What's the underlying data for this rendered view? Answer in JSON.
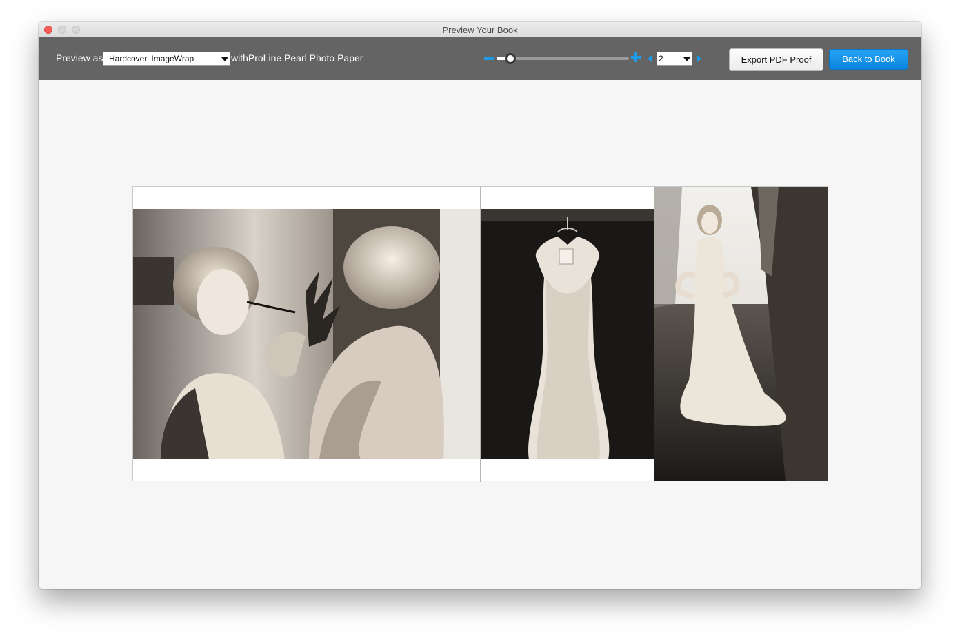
{
  "window": {
    "title": "Preview Your Book"
  },
  "toolbar": {
    "preview_as_label": "Preview as",
    "cover_select_value": "Hardcover, ImageWrap",
    "paper_label": "withProLine Pearl Photo Paper",
    "zoom_level": 0.08,
    "page_value": "2",
    "export_button_label": "Export PDF Proof",
    "back_button_label": "Back to Book"
  },
  "icons": {
    "zoom_out": "minus-icon",
    "zoom_in": "plus-icon",
    "prev_page": "chevron-left-icon",
    "next_page": "chevron-right-icon"
  },
  "colors": {
    "accent": "#1e9be6",
    "toolbar_bg": "#646464",
    "primary_button": "#0a84e0",
    "canvas_bg": "#f6f6f6"
  }
}
